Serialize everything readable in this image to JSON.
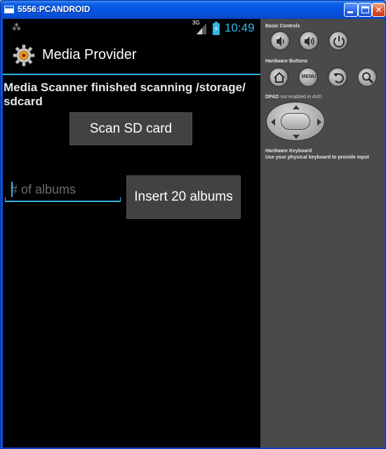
{
  "window": {
    "title": "5556:PCANDROID"
  },
  "status_bar": {
    "network_label": "3G",
    "time": "10:49",
    "accent_color": "#33b5e5"
  },
  "action_bar": {
    "app_title": "Media Provider",
    "app_icon": "gear-icon"
  },
  "content": {
    "scan_status_text": "Media Scanner finished scanning /storage/ sdcard",
    "scan_button_label": "Scan SD card",
    "albums_input_value": "",
    "albums_input_placeholder": "# of albums",
    "insert_button_label": "Insert 20 albums"
  },
  "controls_panel": {
    "basic_controls_label": "Basic Controls",
    "basic_controls": [
      "volume-down-icon",
      "volume-up-icon",
      "power-icon"
    ],
    "hardware_buttons_label": "Hardware Buttons",
    "hardware_buttons": [
      "home-icon",
      "menu-button",
      "back-icon",
      "search-icon"
    ],
    "menu_label": "MENU",
    "dpad_label": "DPAD",
    "dpad_note": "not enabled in AVD",
    "keyboard_label": "Hardware Keyboard",
    "keyboard_note": "Use your physical keyboard to provide input"
  }
}
